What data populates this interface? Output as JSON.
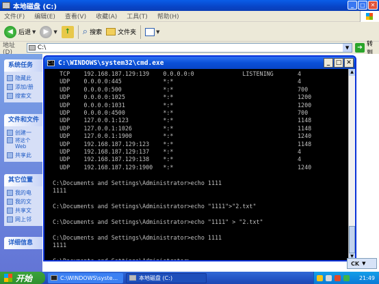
{
  "explorer": {
    "title": "本地磁盘 (C:)",
    "menu": [
      "文件(F)",
      "编辑(E)",
      "查看(V)",
      "收藏(A)",
      "工具(T)",
      "帮助(H)"
    ],
    "toolbar": {
      "back": "后退",
      "search": "搜索",
      "folders": "文件夹"
    },
    "address": {
      "label": "地址(D)",
      "value": "C:\\",
      "go": "转到"
    },
    "panels": {
      "tasks": {
        "title": "系统任务",
        "items": [
          "隐藏此",
          "添加/册",
          "搜索文"
        ]
      },
      "files": {
        "title": "文件和文件",
        "items": [
          "创建一",
          "将这个 Web",
          "共享此"
        ]
      },
      "other": {
        "title": "其它位置",
        "items": [
          "我的电",
          "我的文",
          "共享文",
          "网上邻"
        ]
      },
      "details": {
        "title": "详细信息"
      }
    }
  },
  "cmd": {
    "title": "C:\\WINDOWS\\system32\\cmd.exe",
    "lines": [
      "  TCP    192.168.187.129:139    0.0.0.0:0              LISTENING       4",
      "  UDP    0.0.0.0:445            *:*                                    4",
      "  UDP    0.0.0.0:500            *:*                                    700",
      "  UDP    0.0.0.0:1025           *:*                                    1200",
      "  UDP    0.0.0.0:1031           *:*                                    1200",
      "  UDP    0.0.0.0:4500           *:*                                    700",
      "  UDP    127.0.0.1:123          *:*                                    1148",
      "  UDP    127.0.0.1:1026         *:*                                    1148",
      "  UDP    127.0.0.1:1900         *:*                                    1240",
      "  UDP    192.168.187.129:123    *:*                                    1148",
      "  UDP    192.168.187.129:137    *:*                                    4",
      "  UDP    192.168.187.129:138    *:*                                    4",
      "  UDP    192.168.187.129:1900   *:*                                    1240",
      "",
      "C:\\Documents and Settings\\Administrator>echo 1111",
      "1111",
      "",
      "C:\\Documents and Settings\\Administrator>echo \"1111\">\"2.txt\"",
      "",
      "C:\\Documents and Settings\\Administrator>echo \"1111\" > \"2.txt\"",
      "",
      "C:\\Documents and Settings\\Administrator>echo 1111",
      "1111",
      "",
      "C:\\Documents and Settings\\Administrator>"
    ]
  },
  "ime": {
    "label": "CK"
  },
  "taskbar": {
    "start": "开始",
    "tasks": [
      "C:\\WINDOWS\\syste...",
      "本地磁盘 (C:)"
    ],
    "clock": "21:49"
  }
}
